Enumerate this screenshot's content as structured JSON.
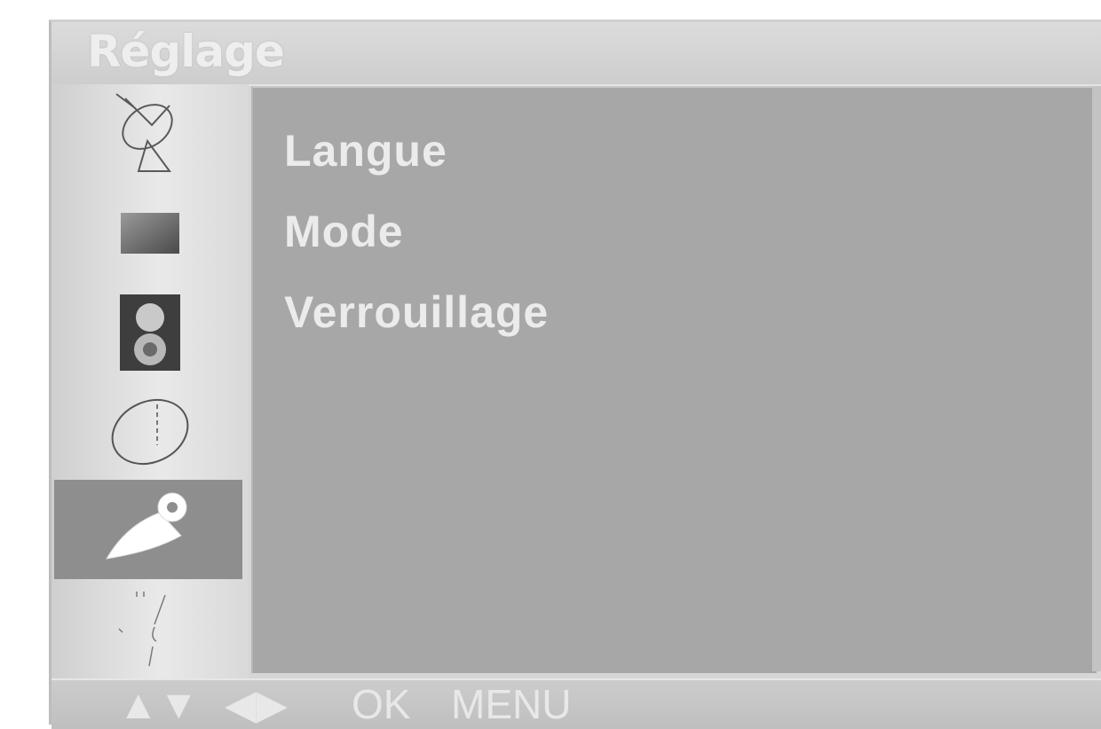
{
  "title": "Réglage",
  "sidebar": {
    "items": [
      {
        "icon": "satellite-dish-icon"
      },
      {
        "icon": "picture-icon"
      },
      {
        "icon": "speaker-icon"
      },
      {
        "icon": "clock-icon"
      },
      {
        "icon": "wrench-icon",
        "selected": true
      },
      {
        "icon": "options-icon"
      }
    ]
  },
  "menu": {
    "items": [
      "Langue",
      "Mode",
      "Verrouillage"
    ]
  },
  "footer": {
    "updown": "▲▼",
    "leftright": "◀▶",
    "ok": "OK",
    "menu": "MENU"
  },
  "colors": {
    "panel": "#a7a7a7",
    "selected": "#8e8e8e",
    "text": "#ebebeb"
  }
}
